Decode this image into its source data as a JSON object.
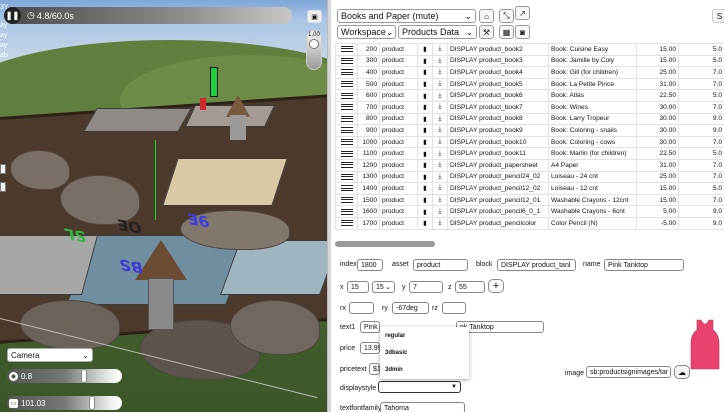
{
  "viewport": {
    "pause_icon": "pause-icon",
    "time_label": "4.8/60.0s",
    "camera_button": "camera-icon",
    "zoom_value": "1.00",
    "camera_select": "Camera",
    "slider1": {
      "label": "0.8",
      "fraction": 0.68
    },
    "slider2": {
      "label": "101.03",
      "fraction": 0.75
    },
    "zoom_fraction": 0.2,
    "scene_text": [
      "3Y",
      "ay",
      "ay",
      "ay",
      "ab"
    ],
    "watermarks": [
      "SL",
      "OE",
      "9E",
      "BS"
    ],
    "colors": {
      "sky": "#a9c5e6",
      "grass": "#4f6f33",
      "board": "#4b3a2c"
    }
  },
  "toolbar": {
    "project_select": "Books and Paper (mute)",
    "workspace_select": "Workspace",
    "products_select": "Products Data",
    "right_button": "S"
  },
  "table": {
    "rows": [
      [
        "200",
        "product",
        "DISPLAY product_book2",
        "Book: Cuisine Easy",
        "15.00",
        "5.0"
      ],
      [
        "300",
        "product",
        "DISPLAY product_book3",
        "Book: Jamille by Coly",
        "15.00",
        "5.0"
      ],
      [
        "400",
        "product",
        "DISPLAY product_book4",
        "Book: Gill (for children)",
        "25.00",
        "7.0"
      ],
      [
        "500",
        "product",
        "DISPLAY product_book5",
        "Book: La Petite Pince",
        "31.00",
        "7.0"
      ],
      [
        "600",
        "product",
        "DISPLAY product_book6",
        "Book: Atlas",
        "22.50",
        "5.0"
      ],
      [
        "700",
        "product",
        "DISPLAY product_book7",
        "Book: Wines",
        "30.00",
        "7.0"
      ],
      [
        "800",
        "product",
        "DISPLAY product_book8",
        "Book: Larry Tropeur",
        "30.00",
        "9.0"
      ],
      [
        "900",
        "product",
        "DISPLAY product_book9",
        "Book: Coloring - snails",
        "30.00",
        "9.0"
      ],
      [
        "1000",
        "product",
        "DISPLAY product_book10",
        "Book: Coloring - cows",
        "30.00",
        "7.0"
      ],
      [
        "1100",
        "product",
        "DISPLAY product_book11",
        "Book: Marlin (for children)",
        "22.50",
        "5.0"
      ],
      [
        "1200",
        "product",
        "DISPLAY product_papersheet",
        "A4 Paper",
        "31.00",
        "7.0"
      ],
      [
        "1300",
        "product",
        "DISPLAY product_pencil24_02",
        "Loiseau - 24 cnt",
        "25.00",
        "7.0"
      ],
      [
        "1400",
        "product",
        "DISPLAY product_pencil12_02",
        "Loiseau - 12 cnt",
        "15.00",
        "5.0"
      ],
      [
        "1500",
        "product",
        "DISPLAY product_pencil12_01",
        "Washable Crayons - 12cnt",
        "15.00",
        "7.0"
      ],
      [
        "1600",
        "product",
        "DISPLAY product_pencil6_0_1",
        "Washable Crayons - 6cnt",
        "5.00",
        "9.0"
      ],
      [
        "1700",
        "product",
        "DISPLAY product_pencilcolor",
        "Color Pencil (N)",
        "-5.00",
        "9.0"
      ]
    ]
  },
  "form": {
    "index_label": "index",
    "index_value": "1800",
    "asset_label": "asset",
    "asset_value": "product",
    "block_label": "block",
    "block_value": "DISPLAY product_tanl",
    "name_label": "name",
    "name_value": "Pink Tanktop",
    "x_label": "x",
    "x_value": "15",
    "x_select": "15",
    "y_label": "y",
    "y_value": "7",
    "z_label": "z",
    "z_value": "55",
    "add_button": "+",
    "rx_label": "rx",
    "rx_value": "",
    "ry_label": "ry",
    "ry_value": "-67deg",
    "rz_label": "rz",
    "rz_value": "",
    "text1_label": "text1",
    "text1_value": "Pink T",
    "text2_value": "nk Tanktop",
    "price_label": "price",
    "price_value": "13.99",
    "pricetext_label": "pricetext",
    "pricetext_value": "$1",
    "displaystyle_label": "displaystyle",
    "displaystyle_value": "",
    "image_label": "image",
    "image_value": "sb:productsignimages/tar",
    "textfontfamily_label": "textfontfamily",
    "textfontfamily_value": "Tahoma",
    "dropdown_options": [
      "regular",
      "3dbasic",
      "3dmin"
    ],
    "preview_icon": "pink-tanktop-image",
    "preview_color": "#e9426e"
  }
}
